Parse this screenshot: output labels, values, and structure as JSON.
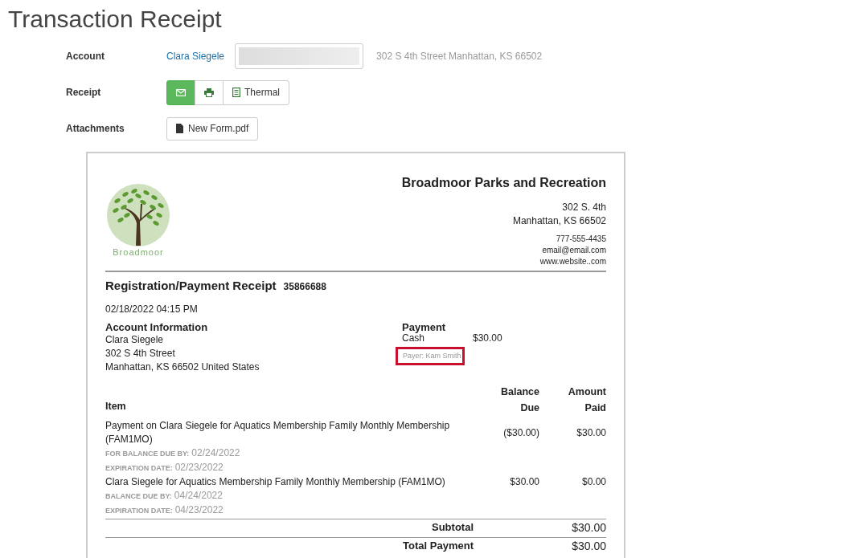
{
  "page_title": "Transaction Receipt",
  "account": {
    "label": "Account",
    "name": "Clara Siegele",
    "address": "302 S 4th Street Manhattan, KS 66502"
  },
  "receipt": {
    "label": "Receipt",
    "buttons": [
      {
        "kind": "email",
        "selected": true
      },
      {
        "kind": "print",
        "selected": false
      },
      {
        "kind": "thermal",
        "label": "Thermal",
        "selected": false
      }
    ]
  },
  "attachments": {
    "label": "Attachments",
    "files": [
      "New Form.pdf"
    ]
  },
  "document": {
    "org_name": "Broadmoor Parks and Recreation",
    "logo_text": "Broadmoor",
    "address_lines": [
      "302 S. 4th",
      "Manhattan, KS 66502"
    ],
    "contact_lines": [
      "777-555-4435",
      "email@email.com",
      "www.website..com"
    ],
    "title": "Registration/Payment Receipt",
    "number": "35866688",
    "datetime": "02/18/2022 04:15 PM",
    "account_heading": "Account Information",
    "account_lines": [
      "Clara Siegele",
      "302 S 4th Street",
      "Manhattan, KS 66502 United States"
    ],
    "payment_heading": "Payment",
    "payment_method": "Cash",
    "payment_amount": "$30.00",
    "payer": "Payer: Kam Smith",
    "payer_highlighted": true,
    "columns": [
      "Item",
      "Balance Due",
      "Amount Paid"
    ],
    "items": [
      {
        "description": "Payment on Clara Siegele for Aquatics Membership Family Monthly Membership (FAM1MO)",
        "details": [
          {
            "label": "FOR BALANCE DUE BY:",
            "value": "02/24/2022"
          },
          {
            "label": "EXPIRATION DATE:",
            "value": "02/23/2022"
          }
        ],
        "balance_due": "($30.00)",
        "amount_paid": "$30.00"
      },
      {
        "description": "Clara Siegele for Aquatics Membership Family Monthly Membership (FAM1MO)",
        "details": [
          {
            "label": "BALANCE DUE BY:",
            "value": "04/24/2022"
          },
          {
            "label": "EXPIRATION DATE:",
            "value": "04/23/2022"
          }
        ],
        "balance_due": "$30.00",
        "amount_paid": "$0.00"
      }
    ],
    "totals": [
      {
        "label": "Subtotal",
        "value": "$30.00"
      },
      {
        "label": "Total Payment",
        "value": "$30.00"
      }
    ]
  }
}
